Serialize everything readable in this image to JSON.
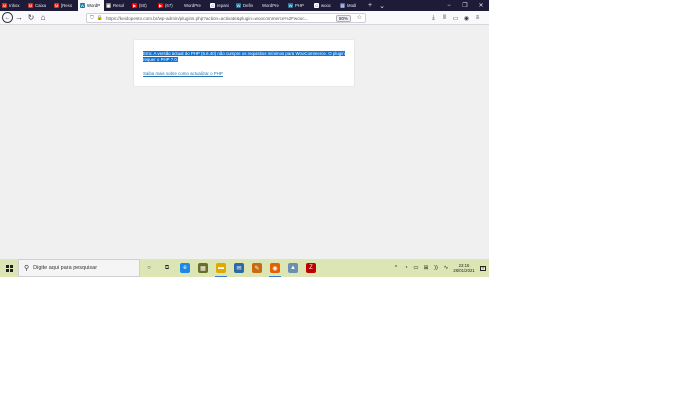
{
  "browser": {
    "tabs": [
      {
        "label": "Inbox",
        "icon": "gmail-icon",
        "color": "#d93025",
        "glyph": "M"
      },
      {
        "label": "Caixa",
        "icon": "gmail-icon",
        "color": "#d93025",
        "glyph": "M"
      },
      {
        "label": "[Reso",
        "icon": "gmail-icon",
        "color": "#d93025",
        "glyph": "M"
      },
      {
        "label": "WordP",
        "icon": "wordpress-icon",
        "color": "#21759b",
        "glyph": "W",
        "active": true
      },
      {
        "label": "Resol",
        "icon": "puzzle-icon",
        "color": "#8a8a8a",
        "glyph": "▣"
      },
      {
        "label": "(50)",
        "icon": "youtube-icon",
        "color": "#ff0000",
        "glyph": "▶"
      },
      {
        "label": "(67)",
        "icon": "youtube-icon",
        "color": "#ff0000",
        "glyph": "▶"
      },
      {
        "label": "WordPre",
        "icon": "",
        "color": "",
        "glyph": ""
      },
      {
        "label": "reparo",
        "icon": "google-icon",
        "color": "#ffffff",
        "glyph": "G"
      },
      {
        "label": "Defin",
        "icon": "wordpress-icon",
        "color": "#21759b",
        "glyph": "W"
      },
      {
        "label": "WordPre",
        "icon": "",
        "color": "",
        "glyph": ""
      },
      {
        "label": "PHP",
        "icon": "wordpress-icon",
        "color": "#21759b",
        "glyph": "W"
      },
      {
        "label": "wooc",
        "icon": "google-icon",
        "color": "#ffffff",
        "glyph": "G"
      },
      {
        "label": "Modi",
        "icon": "generic-page-icon",
        "color": "#5b6ea6",
        "glyph": "▤"
      }
    ],
    "new_tab": "+",
    "tab_menu": "⌄",
    "window_controls": [
      "−",
      "❐",
      "✕"
    ],
    "url": "https://keidopesto.com.br/wp-admin/plugins.php?action=activate&plugin=woocommerce%2Fwooc...",
    "zoom": "80%",
    "nav_icons": {
      "back": "←",
      "forward": "→",
      "reload": "↻",
      "home": "⌂",
      "shield": "⛉",
      "lock": "🔒",
      "star": "☆",
      "right": [
        "⤓",
        "⫴",
        "▭",
        "◉",
        "≡"
      ]
    }
  },
  "page": {
    "error_text": "Erro: A versão actual do PHP (5.6.40) não cumpre os requisitos mínimos para WooCommerce. O plugin requer o PHP 7.0.",
    "help_link": "Saiba mais sobre como actualizar o PHP"
  },
  "taskbar": {
    "search_placeholder": "Digite aqui para pesquisar",
    "search_icon": "⚲",
    "apps": [
      {
        "name": "cortana-icon",
        "glyph": "○",
        "color": "#1f1f1f",
        "run": false
      },
      {
        "name": "task-view-icon",
        "glyph": "⧉",
        "color": "#1f1f1f",
        "run": false
      },
      {
        "name": "edge-icon",
        "glyph": "e",
        "color": "#1e88e5",
        "run": false
      },
      {
        "name": "store-icon",
        "glyph": "▦",
        "color": "#6d6d2a",
        "run": false
      },
      {
        "name": "explorer-icon",
        "glyph": "▬",
        "color": "#e0a800",
        "run": true
      },
      {
        "name": "mail-icon",
        "glyph": "✉",
        "color": "#2d6aa3",
        "run": false
      },
      {
        "name": "paint-icon",
        "glyph": "✎",
        "color": "#c76a10",
        "run": false
      },
      {
        "name": "firefox-icon",
        "glyph": "◉",
        "color": "#e66000",
        "run": true
      },
      {
        "name": "photos-icon",
        "glyph": "▲",
        "color": "#6a8fb3",
        "run": false
      },
      {
        "name": "filezilla-icon",
        "glyph": "Z",
        "color": "#bf0000",
        "run": false
      }
    ],
    "tray": [
      "^",
      "◔",
      "▭",
      "⊞",
      "))",
      "∿"
    ],
    "time": "23:15",
    "date": "28/01/2021",
    "notification": "≡"
  },
  "colors": {
    "tabbar": "#1d1b38",
    "taskbar": "#dbe6b4",
    "error_highlight": "#0a74da",
    "link": "#2271b1"
  }
}
